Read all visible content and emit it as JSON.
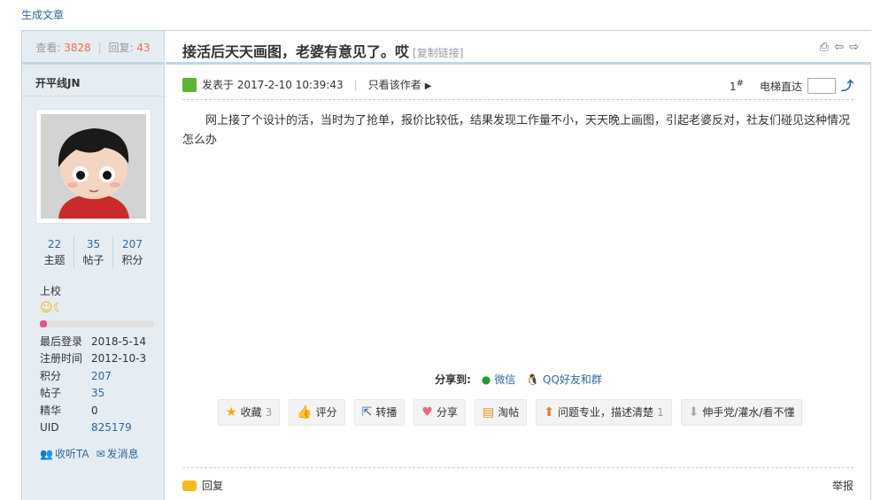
{
  "top_link": "生成文章",
  "sidebar": {
    "views_label": "查看:",
    "views": "3828",
    "sep": "|",
    "replies_label": "回复:",
    "replies": "43",
    "author": "开平线JN",
    "stats": [
      {
        "value": "22",
        "label": "主题"
      },
      {
        "value": "35",
        "label": "帖子"
      },
      {
        "value": "207",
        "label": "积分"
      }
    ],
    "rank": "上校",
    "progress": 0.06,
    "info": [
      {
        "key": "最后登录",
        "value": "2018-5-14",
        "link": false
      },
      {
        "key": "注册时间",
        "value": "2012-10-3",
        "link": false
      },
      {
        "key": "积分",
        "value": "207",
        "link": true
      },
      {
        "key": "帖子",
        "value": "35",
        "link": true
      },
      {
        "key": "精华",
        "value": "0",
        "link": false
      },
      {
        "key": "UID",
        "value": "825179",
        "link": true
      }
    ],
    "follow_label": "收听TA",
    "message_label": "发消息"
  },
  "post": {
    "title": "接活后天天画图，老婆有意见了。哎",
    "copy_link": "[复制链接]",
    "posted_on": "发表于 2017-2-10 10:39:43",
    "only_author": "只看该作者",
    "floor": "1",
    "floor_mark": "#",
    "jump_label": "电梯直达",
    "content": "网上接了个设计的活，当时为了抢单，报价比较低，结果发现工作量不小，天天晚上画图，引起老婆反对，社友们碰见这种情况怎么办"
  },
  "share": {
    "label": "分享到:",
    "wechat": "微信",
    "qq": "QQ好友和群"
  },
  "buttons": [
    {
      "label": "收藏",
      "count": "3",
      "icon": "star-icon"
    },
    {
      "label": "评分",
      "count": "",
      "icon": "thumb-icon"
    },
    {
      "label": "转播",
      "count": "",
      "icon": "forward-icon"
    },
    {
      "label": "分享",
      "count": "",
      "icon": "heart-icon"
    },
    {
      "label": "淘帖",
      "count": "",
      "icon": "tray-icon"
    },
    {
      "label": "问题专业，描述清楚",
      "count": "1",
      "icon": "up-arrow-icon"
    },
    {
      "label": "伸手党/灌水/看不懂",
      "count": "",
      "icon": "down-arrow-icon"
    }
  ],
  "footer": {
    "reply": "回复",
    "report": "举报"
  }
}
